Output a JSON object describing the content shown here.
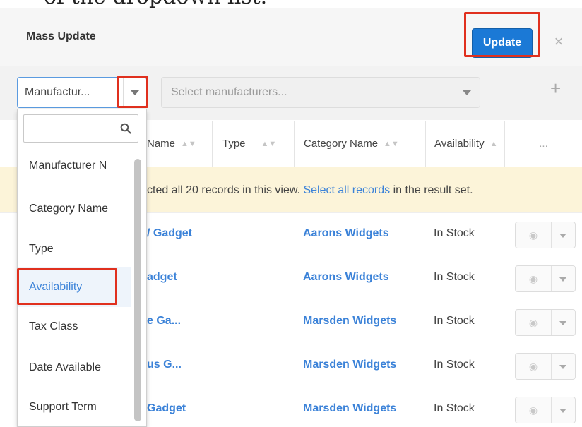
{
  "caption": "of the dropdown list.",
  "header": {
    "title": "Mass Update",
    "update_label": "Update",
    "close_symbol": "×"
  },
  "field_selector": {
    "value": "Manufactur...",
    "values_placeholder": "Select manufacturers...",
    "add_symbol": "+"
  },
  "dropdown": {
    "items": [
      "Manufacturer N",
      "Category Name",
      "Type",
      "Availability",
      "Tax Class",
      "Date Available",
      "Support Term"
    ],
    "selected": "Availability"
  },
  "table": {
    "columns": [
      "Name",
      "Type",
      "Category Name",
      "Availability",
      "..."
    ],
    "banner": {
      "prefix": "cted all 20 records in this view. ",
      "link": "Select all records",
      "suffix": " in the result set."
    },
    "rows": [
      {
        "name": "/ Gadget",
        "category": "Aarons Widgets",
        "availability": "In Stock"
      },
      {
        "name": "adget",
        "category": "Aarons Widgets",
        "availability": "In Stock"
      },
      {
        "name": "e Ga...",
        "category": "Marsden Widgets",
        "availability": "In Stock"
      },
      {
        "name": "us G...",
        "category": "Marsden Widgets",
        "availability": "In Stock"
      },
      {
        "name": "Gadget",
        "category": "Marsden Widgets",
        "availability": "In Stock"
      }
    ]
  },
  "colors": {
    "primary": "#1b79d6",
    "link": "#3b82d8",
    "highlight": "#e0301e",
    "banner": "#fcf4d9"
  }
}
